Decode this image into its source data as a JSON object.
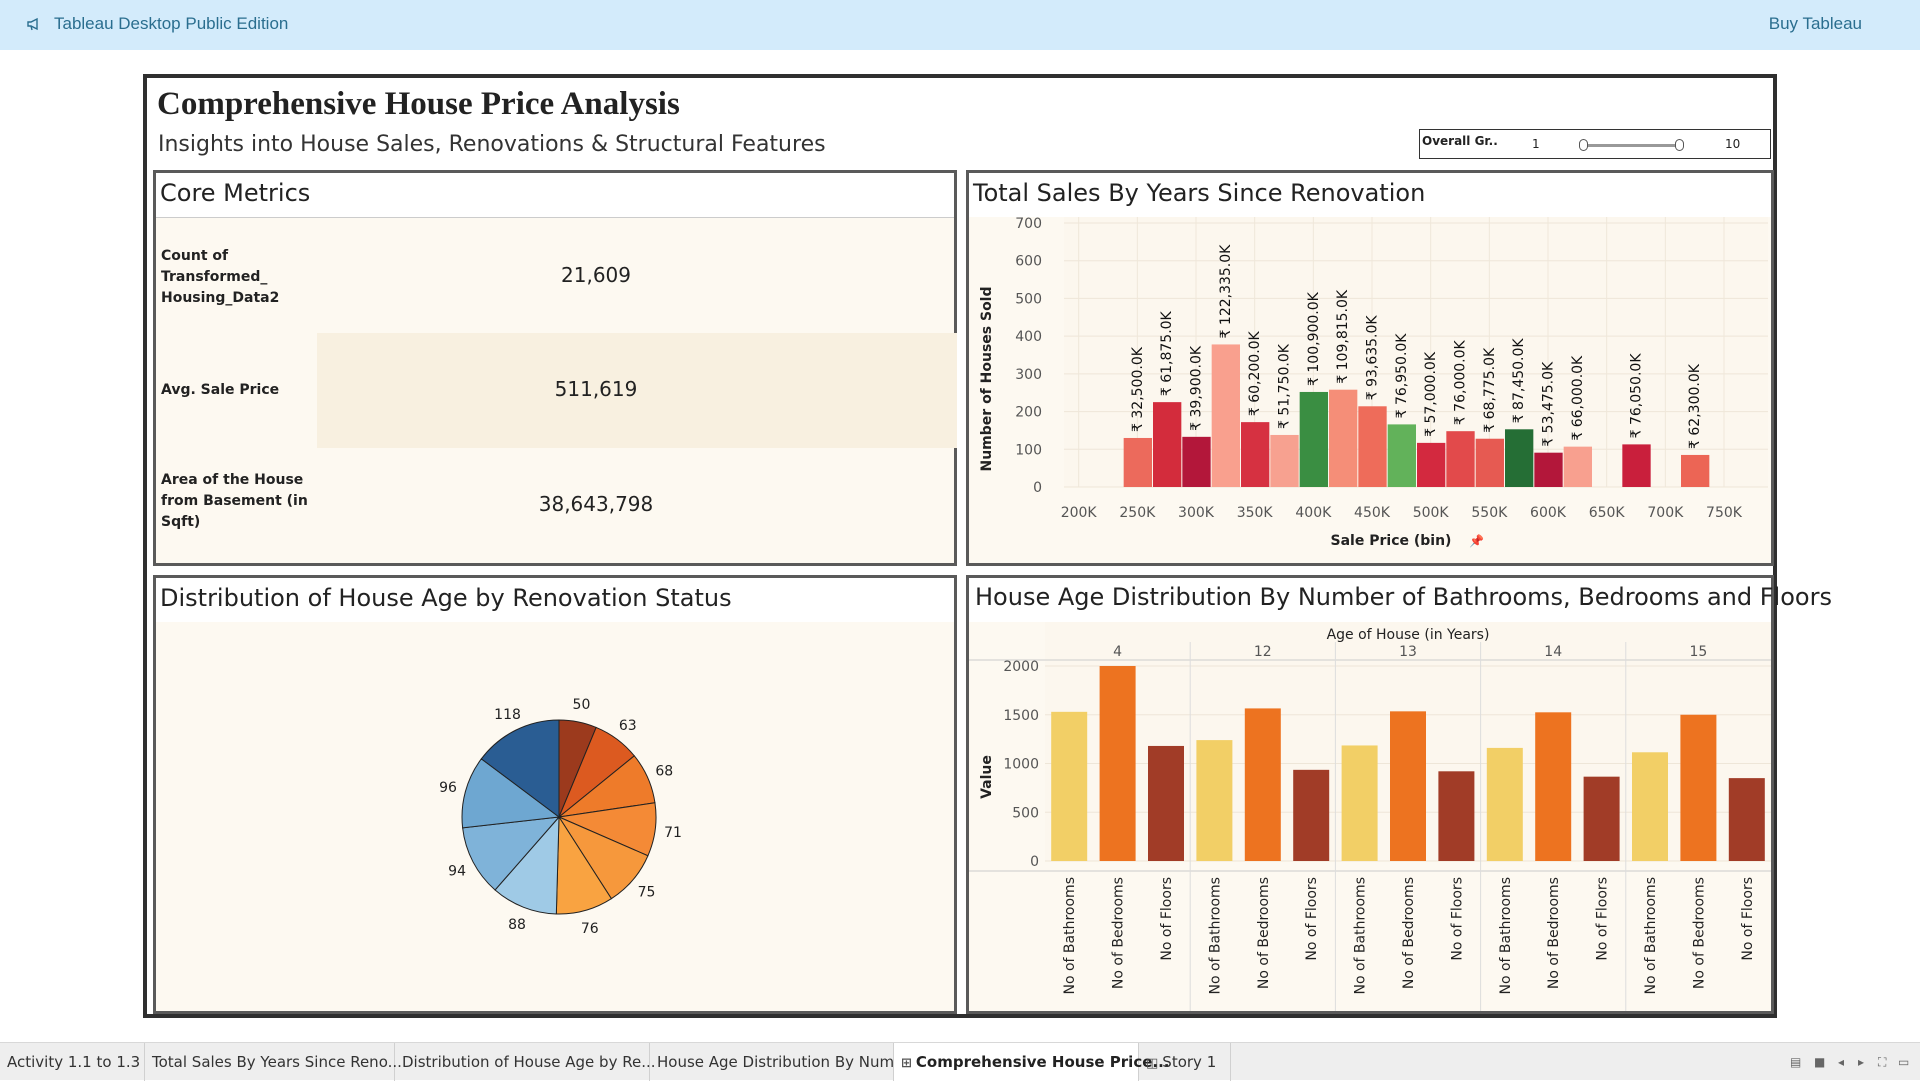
{
  "app": {
    "title": "Tableau Desktop Public Edition",
    "buy_label": "Buy Tableau"
  },
  "dashboard": {
    "title": "Comprehensive House Price Analysis",
    "subtitle": "Insights into House Sales, Renovations & Structural Features",
    "filter": {
      "label": "Overall Gr..",
      "min": "1",
      "max": "10",
      "range_low": 1,
      "range_high": 10
    }
  },
  "core_metrics": {
    "title": "Core Metrics",
    "rows": [
      {
        "label_lines": [
          "Count of",
          "Transformed_",
          "Housing_Data2"
        ],
        "value": "21,609"
      },
      {
        "label_lines": [
          "Avg. Sale Price"
        ],
        "value": "511,619"
      },
      {
        "label_lines": [
          "Area of the House",
          "from Basement (in",
          "Sqft)"
        ],
        "value": "38,643,798"
      }
    ]
  },
  "pie_panel": {
    "title": "Distribution of House Age by Renovation Status"
  },
  "bar_panel": {
    "title": "Total Sales By Years Since Renovation"
  },
  "group_panel": {
    "title": "House Age Distribution By Number of Bathrooms, Bedrooms and Floors"
  },
  "chart_data": [
    {
      "type": "bar",
      "title": "Total Sales By Years Since Renovation",
      "xlabel": "Sale Price (bin)",
      "ylabel": "Number of Houses Sold",
      "ylim": [
        0,
        700
      ],
      "y_ticks": [
        0,
        100,
        200,
        300,
        400,
        500,
        600,
        700
      ],
      "x_ticks": [
        "200K",
        "250K",
        "300K",
        "350K",
        "400K",
        "450K",
        "500K",
        "550K",
        "600K",
        "650K",
        "700K",
        "750K"
      ],
      "x_tick_values": [
        200000,
        250000,
        300000,
        350000,
        400000,
        450000,
        500000,
        550000,
        600000,
        650000,
        700000,
        750000
      ],
      "bin_width": 25000,
      "bars": [
        {
          "x": 250000,
          "value": 130,
          "label": "₹ 32,500.0K",
          "color": "#ec6a5c"
        },
        {
          "x": 275000,
          "value": 225,
          "label": "₹ 61,875.0K",
          "color": "#d32c3c"
        },
        {
          "x": 300000,
          "value": 133,
          "label": "₹ 39,900.0K",
          "color": "#b3173a"
        },
        {
          "x": 325000,
          "value": 378,
          "label": "₹ 122,335.0K",
          "color": "#f9a08e"
        },
        {
          "x": 350000,
          "value": 172,
          "label": "₹ 60,200.0K",
          "color": "#d63141"
        },
        {
          "x": 375000,
          "value": 138,
          "label": "₹ 51,750.0K",
          "color": "#f7a190"
        },
        {
          "x": 400000,
          "value": 252,
          "label": "₹ 100,900.0K",
          "color": "#3a8e42"
        },
        {
          "x": 425000,
          "value": 258,
          "label": "₹ 109,815.0K",
          "color": "#f58e78"
        },
        {
          "x": 450000,
          "value": 214,
          "label": "₹ 93,635.0K",
          "color": "#ee6c5a"
        },
        {
          "x": 475000,
          "value": 166,
          "label": "₹ 76,950.0K",
          "color": "#62b25a"
        },
        {
          "x": 500000,
          "value": 117,
          "label": "₹ 57,000.0K",
          "color": "#d3293f"
        },
        {
          "x": 525000,
          "value": 148,
          "label": "₹ 76,000.0K",
          "color": "#e24a4b"
        },
        {
          "x": 550000,
          "value": 128,
          "label": "₹ 68,775.0K",
          "color": "#e65a52"
        },
        {
          "x": 575000,
          "value": 153,
          "label": "₹ 87,450.0K",
          "color": "#256e35"
        },
        {
          "x": 600000,
          "value": 91,
          "label": "₹ 53,475.0K",
          "color": "#b3173a"
        },
        {
          "x": 625000,
          "value": 107,
          "label": "₹ 66,000.0K",
          "color": "#f8a08f"
        },
        {
          "x": 675000,
          "value": 113,
          "label": "₹ 76,050.0K",
          "color": "#c91f3c"
        },
        {
          "x": 725000,
          "value": 85,
          "label": "₹ 62,300.0K",
          "color": "#ec6555"
        }
      ]
    },
    {
      "type": "pie",
      "title": "Distribution of House Age by Renovation Status",
      "values": [
        50,
        63,
        68,
        71,
        75,
        76,
        88,
        94,
        96,
        118
      ],
      "colors": [
        "#9c3a1d",
        "#dc5a20",
        "#ee7b2a",
        "#f48a36",
        "#f6983c",
        "#f9a341",
        "#9fcae6",
        "#7fb3d9",
        "#6ea7d1",
        "#2a5d93"
      ]
    },
    {
      "type": "bar",
      "title": "House Age Distribution By Number of Bathrooms, Bedrooms and Floors",
      "xlabel": "Age of House (in Years)",
      "ylabel": "Value",
      "ylim": [
        0,
        2000
      ],
      "y_ticks": [
        0,
        500,
        1000,
        1500,
        2000
      ],
      "groups": [
        "4",
        "12",
        "13",
        "14",
        "15"
      ],
      "categories": [
        "No of Bathrooms",
        "No of Bedrooms",
        "No of Floors"
      ],
      "colors": [
        "#f2cf66",
        "#ed7320",
        "#a13c27"
      ],
      "series": [
        {
          "name": "No of Bathrooms",
          "values": [
            1530,
            1240,
            1185,
            1160,
            1115
          ]
        },
        {
          "name": "No of Bedrooms",
          "values": [
            2000,
            1565,
            1535,
            1525,
            1500
          ]
        },
        {
          "name": "No of Floors",
          "values": [
            1180,
            935,
            920,
            865,
            850
          ]
        }
      ]
    }
  ],
  "tabs": [
    {
      "label": "Activity 1.1 to 1.3"
    },
    {
      "label": "Total Sales By Years Since Reno..."
    },
    {
      "label": "Distribution of House Age by Re..."
    },
    {
      "label": "House Age Distribution By Num..."
    },
    {
      "label": "Comprehensive House Price...",
      "icon": "dashboard-icon",
      "active": true
    },
    {
      "label": "Story 1",
      "icon": "story-icon"
    }
  ]
}
